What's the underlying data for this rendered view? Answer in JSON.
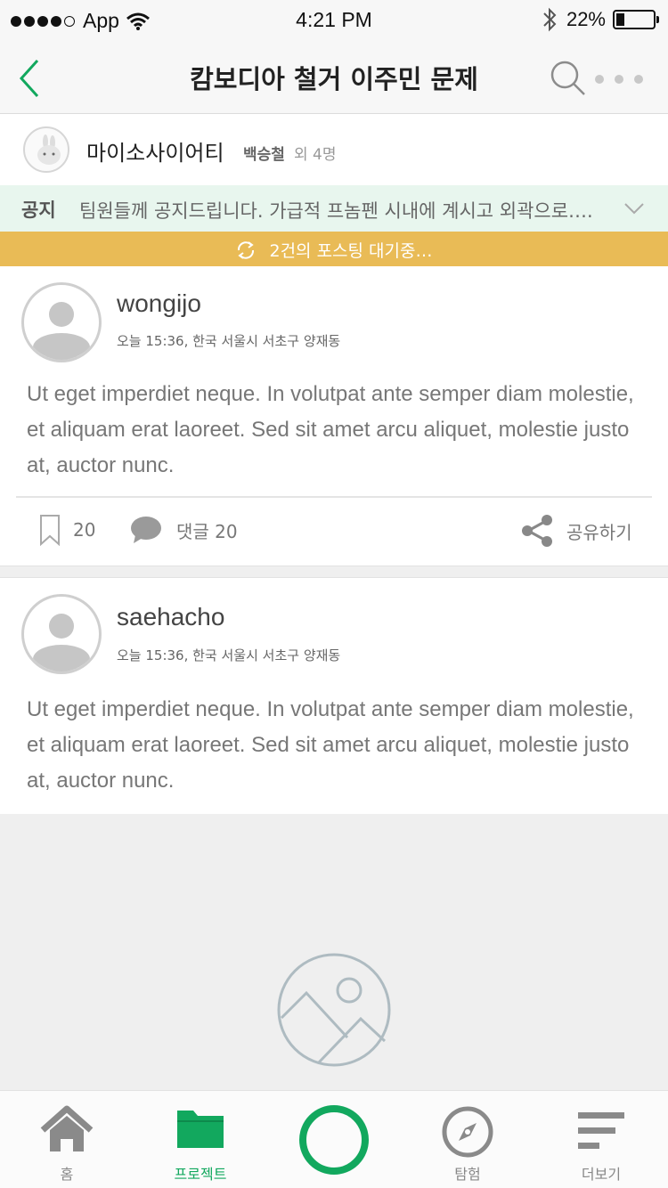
{
  "status_bar": {
    "carrier": "App",
    "time": "4:21 PM",
    "battery_percent": "22%",
    "battery_level": 0.22
  },
  "nav": {
    "title": "캄보디아 철거 이주민 문제",
    "back_icon": "chevron-left-icon",
    "search_icon": "search-icon",
    "more_icon": "more-dots-icon",
    "accent_color": "#12a85e"
  },
  "group": {
    "name": "마이소사이어티",
    "owner": "백승철",
    "extra": "외 4명"
  },
  "notice": {
    "label": "공지",
    "text": "팀원들께 공지드립니다. 가급적 프놈펜 시내에 계시고 외곽으로…."
  },
  "pending": {
    "text": "2건의 포스팅 대기중…",
    "color": "#e9bb56"
  },
  "posts": [
    {
      "user": "wongijo",
      "meta": "오늘 15:36, 한국 서울시 서초구 양재동",
      "body": "Ut eget imperdiet neque. In volutpat ante semper diam molestie, et aliquam erat laoreet. Sed sit amet arcu aliquet, molestie justo at, auctor nunc.",
      "bookmark_count": "20",
      "comment_label": "댓글 20",
      "share_label": "공유하기"
    },
    {
      "user": "saehacho",
      "meta": "오늘 15:36, 한국 서울시 서초구 양재동",
      "body": "Ut eget imperdiet neque. In volutpat ante semper diam molestie, et aliquam erat laoreet. Sed sit amet arcu aliquet, molestie justo at, auctor nunc."
    }
  ],
  "tabs": [
    {
      "label": "홈",
      "icon": "home-icon",
      "active": false
    },
    {
      "label": "프로젝트",
      "icon": "folder-icon",
      "active": true
    },
    {
      "label": "",
      "icon": "record-circle-icon",
      "active": false
    },
    {
      "label": "탐험",
      "icon": "compass-icon",
      "active": false
    },
    {
      "label": "더보기",
      "icon": "menu-lines-icon",
      "active": false
    }
  ]
}
